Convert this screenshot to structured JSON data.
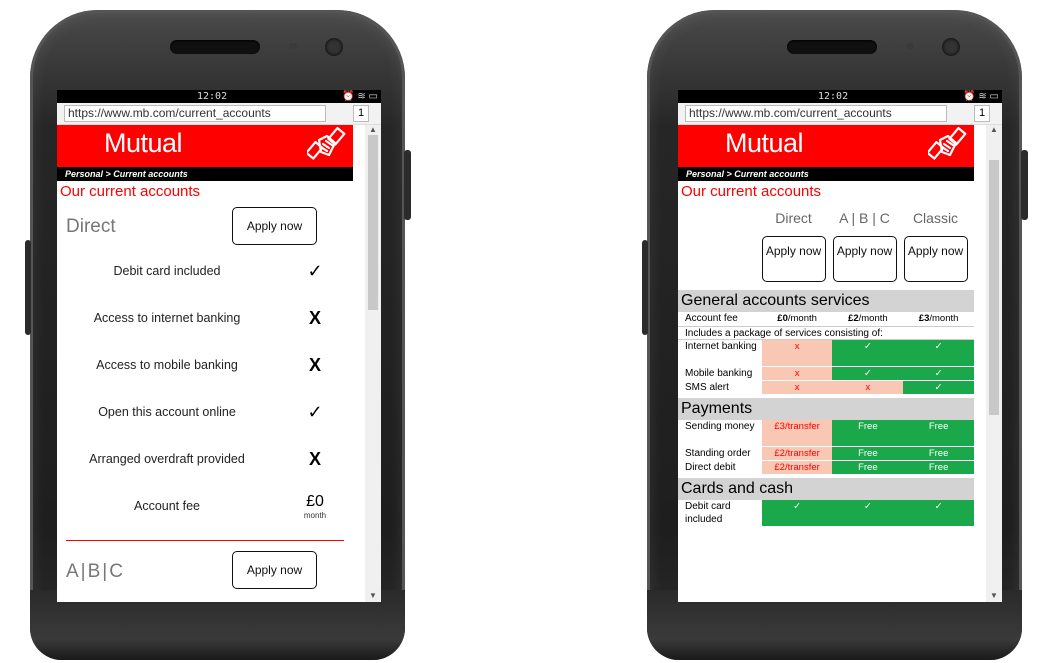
{
  "status": {
    "time": "12:02",
    "icons": "⏰ ≋ ▭"
  },
  "browser": {
    "url": "https://www.mb.com/current_accounts",
    "tab_count": "1"
  },
  "brand": {
    "name": "Mutual"
  },
  "breadcrumb": "Personal > Current accounts",
  "page_title": "Our current accounts",
  "left": {
    "account_name": "Direct",
    "apply_label": "Apply now",
    "features": [
      {
        "label": "Debit card included",
        "value": "✓"
      },
      {
        "label": "Access to internet banking",
        "value": "X"
      },
      {
        "label": "Access to mobile banking",
        "value": "X"
      },
      {
        "label": "Open this account online",
        "value": "✓"
      },
      {
        "label": "Arranged overdraft provided",
        "value": "X"
      }
    ],
    "fee_label": "Account fee",
    "fee_value": "£0",
    "fee_unit": "month",
    "next_account_name": "A|B|C",
    "next_apply_label": "Apply now"
  },
  "right": {
    "columns": [
      "Direct",
      "A | B | C",
      "Classic"
    ],
    "apply_label": "Apply now",
    "sections": {
      "general": "General accounts services",
      "payments": "Payments",
      "cards": "Cards and cash"
    },
    "account_fee": {
      "label": "Account fee",
      "values": [
        {
          "amount": "£0",
          "unit": "/month"
        },
        {
          "amount": "£2",
          "unit": "/month"
        },
        {
          "amount": "£3",
          "unit": "/month"
        }
      ]
    },
    "package_note": "Includes a package of services consisting of:",
    "general_rows": [
      {
        "label": "Internet banking",
        "values": [
          "x",
          "✓",
          "✓"
        ]
      },
      {
        "label": "Mobile banking",
        "values": [
          "x",
          "✓",
          "✓"
        ]
      },
      {
        "label": "SMS alert",
        "values": [
          "x",
          "x",
          "✓"
        ]
      }
    ],
    "payment_rows": [
      {
        "label": "Sending money",
        "values": [
          "£3/transfer",
          "Free",
          "Free"
        ]
      },
      {
        "label": "Standing order",
        "values": [
          "£2/transfer",
          "Free",
          "Free"
        ]
      },
      {
        "label": "Direct debit",
        "values": [
          "£2/transfer",
          "Free",
          "Free"
        ]
      }
    ],
    "card_rows": [
      {
        "label": "Debit card included",
        "values": [
          "✓",
          "✓",
          "✓"
        ]
      }
    ]
  },
  "colors": {
    "brand_red": "#ff0000",
    "yes_green": "#1aa84a",
    "no_pink": "#f8c8b4",
    "section_grey": "#d3d3d3"
  }
}
